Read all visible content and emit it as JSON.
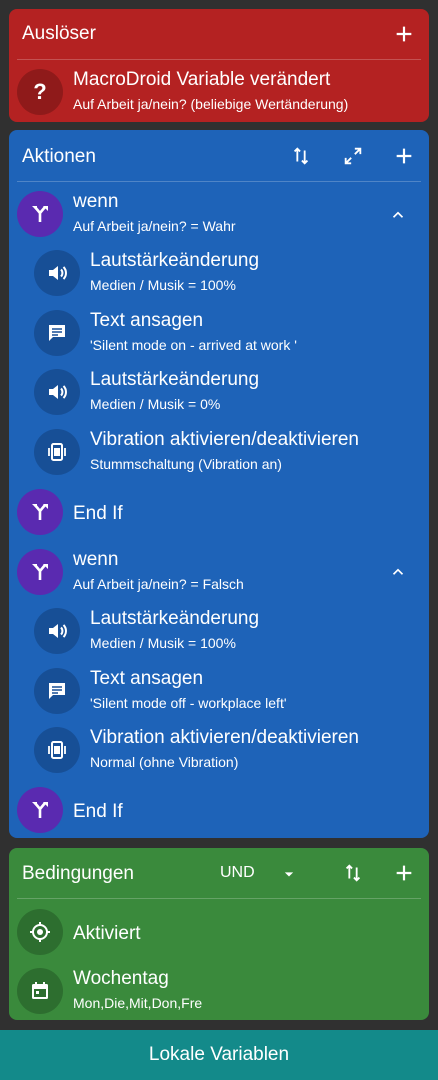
{
  "trigger": {
    "header": "Auslöser",
    "item": {
      "icon": "help-icon",
      "title": "MacroDroid Variable verändert",
      "subtitle": "Auf Arbeit ja/nein?  (beliebige Wertänderung)"
    }
  },
  "actions": {
    "header": "Aktionen",
    "items": [
      {
        "type": "if",
        "title": "wenn",
        "subtitle": "Auf Arbeit ja/nein?  = Wahr"
      },
      {
        "type": "volume",
        "title": "Lautstärkeänderung",
        "subtitle": "Medien / Musik = 100%"
      },
      {
        "type": "speak",
        "title": "Text ansagen",
        "subtitle": "'Silent mode on - arrived at work '"
      },
      {
        "type": "volume",
        "title": "Lautstärkeänderung",
        "subtitle": "Medien / Musik = 0%"
      },
      {
        "type": "vibrate",
        "title": "Vibration aktivieren/deaktivieren",
        "subtitle": "Stummschaltung (Vibration an)"
      },
      {
        "type": "endif",
        "title": "End If"
      },
      {
        "type": "if",
        "title": "wenn",
        "subtitle": "Auf Arbeit ja/nein?  = Falsch"
      },
      {
        "type": "volume",
        "title": "Lautstärkeänderung",
        "subtitle": "Medien / Musik = 100%"
      },
      {
        "type": "speak",
        "title": "Text ansagen",
        "subtitle": "'Silent mode off - workplace left'"
      },
      {
        "type": "vibrate",
        "title": "Vibration aktivieren/deaktivieren",
        "subtitle": "Normal (ohne Vibration)"
      },
      {
        "type": "endif",
        "title": "End If"
      }
    ]
  },
  "conditions": {
    "header": "Bedingungen",
    "logic": "UND",
    "items": [
      {
        "icon": "target-icon",
        "title": "Aktiviert"
      },
      {
        "icon": "calendar-icon",
        "title": "Wochentag",
        "subtitle": "Mon,Die,Mit,Don,Fre"
      }
    ]
  },
  "bottom_bar": {
    "label": "Lokale Variablen"
  },
  "colors": {
    "trigger": "#b42222",
    "actions": "#1e63b8",
    "conditions": "#3a8a3c",
    "bottom": "#138a8a",
    "background": "#303030"
  }
}
